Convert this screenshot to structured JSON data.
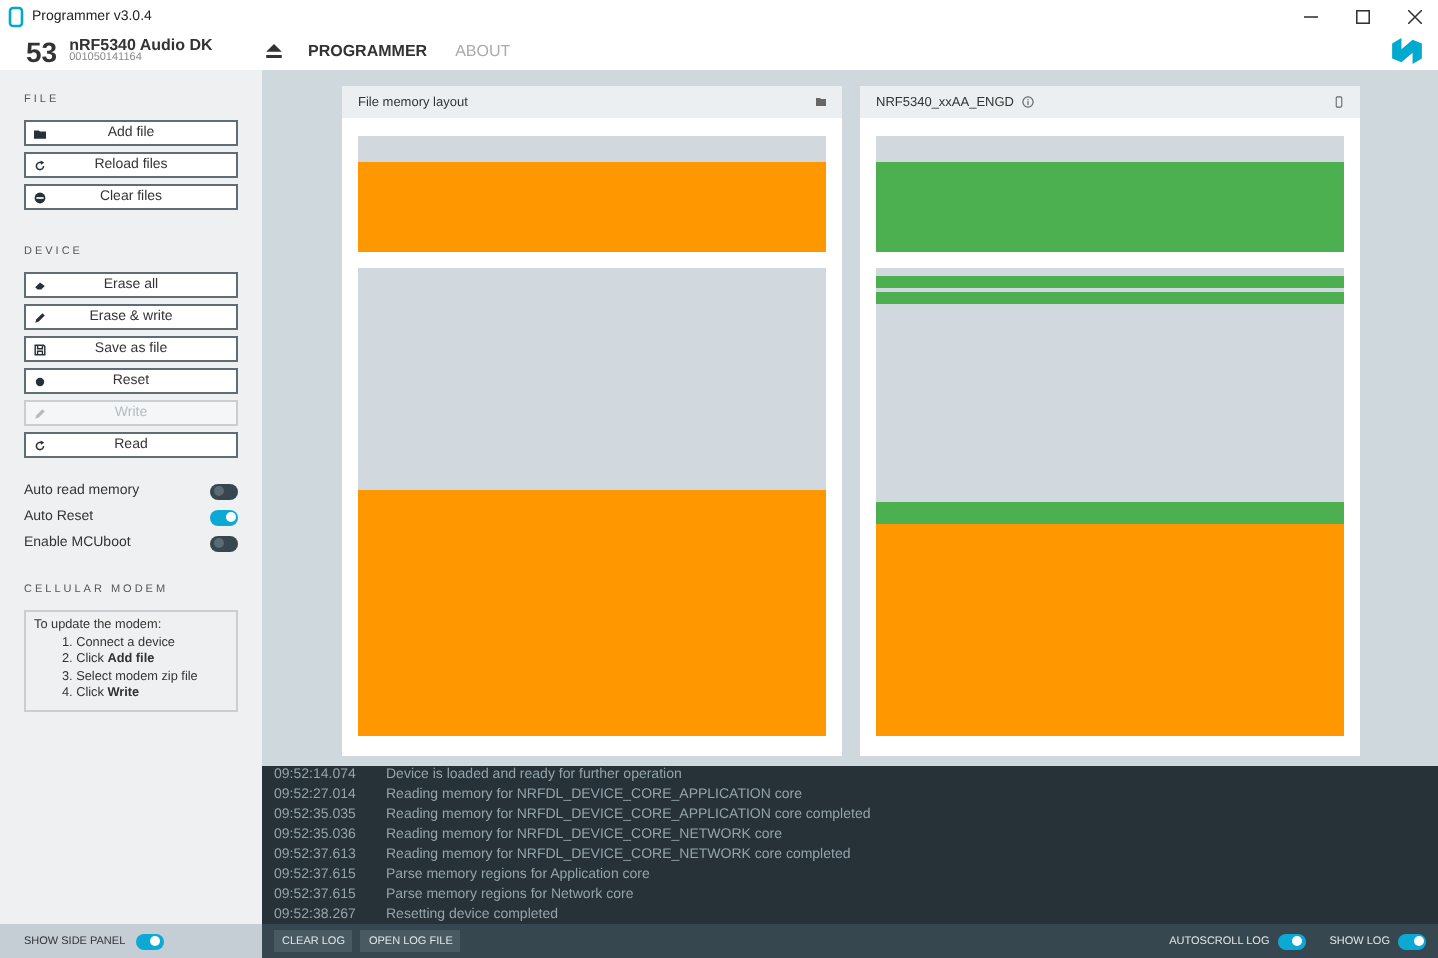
{
  "window": {
    "title": "Programmer v3.0.4"
  },
  "device": {
    "number": "53",
    "name": "nRF5340 Audio DK",
    "serial": "001050141164"
  },
  "nav": [
    {
      "label": "PROGRAMMER",
      "selected": true
    },
    {
      "label": "ABOUT",
      "selected": false
    }
  ],
  "sidebar": {
    "sections": [
      {
        "title": "FILE",
        "buttons": [
          {
            "label": "Add file",
            "kind": "folder",
            "disabled": false
          },
          {
            "label": "Reload files",
            "kind": "reload",
            "disabled": false
          },
          {
            "label": "Clear files",
            "kind": "minus",
            "disabled": false
          }
        ]
      },
      {
        "title": "DEVICE",
        "buttons": [
          {
            "label": "Erase all",
            "kind": "eraser",
            "disabled": false
          },
          {
            "label": "Erase & write",
            "kind": "pencil",
            "disabled": false
          },
          {
            "label": "Save as file",
            "kind": "save",
            "disabled": false
          },
          {
            "label": "Reset",
            "kind": "dot",
            "disabled": false
          },
          {
            "label": "Write",
            "kind": "pencil",
            "disabled": true
          },
          {
            "label": "Read",
            "kind": "reload",
            "disabled": false
          }
        ]
      }
    ],
    "toggles": [
      {
        "label": "Auto read memory",
        "on": false
      },
      {
        "label": "Auto Reset",
        "on": true
      },
      {
        "label": "Enable MCUboot",
        "on": false
      }
    ],
    "modem": {
      "title": "CELLULAR MODEM",
      "intro": "To update the modem:",
      "steps": [
        "1. Connect a device",
        "2. Click **Add file**",
        "3. Select modem zip file",
        "4. Click **Write**"
      ]
    },
    "show_side_panel": {
      "label": "SHOW SIDE PANEL",
      "on": true
    }
  },
  "cards": [
    {
      "title": "File memory layout",
      "kind": "file",
      "blocks": [
        [
          {
            "color": "#d1d9de"
          },
          {
            "color": "#ff9800"
          }
        ],
        [
          {
            "color": "#d1d9de"
          },
          {
            "color": "#ff9800"
          }
        ]
      ]
    },
    {
      "title": "NRF5340_xxAA_ENGD",
      "kind": "device",
      "blocks": [
        [
          {
            "color": "#d1d9de"
          },
          {
            "color": "#4caf50"
          }
        ],
        [
          {
            "color": "#d1d9de"
          },
          {
            "color": "#4caf50"
          },
          {
            "color": "#d1d9de"
          },
          {
            "color": "#4caf50"
          },
          {
            "color": "#d1d9de"
          },
          {
            "color": "#4caf50"
          },
          {
            "color": "#ff9800"
          }
        ]
      ]
    }
  ],
  "log": [
    {
      "time": "09:52:14.074",
      "message": "Device is loaded and ready for further operation"
    },
    {
      "time": "09:52:27.014",
      "message": "Reading memory for NRFDL_DEVICE_CORE_APPLICATION core"
    },
    {
      "time": "09:52:35.035",
      "message": "Reading memory for NRFDL_DEVICE_CORE_APPLICATION core completed"
    },
    {
      "time": "09:52:35.036",
      "message": "Reading memory for NRFDL_DEVICE_CORE_NETWORK core"
    },
    {
      "time": "09:52:37.613",
      "message": "Reading memory for NRFDL_DEVICE_CORE_NETWORK core completed"
    },
    {
      "time": "09:52:37.615",
      "message": "Parse memory regions for Application core"
    },
    {
      "time": "09:52:37.615",
      "message": "Parse memory regions for Network core"
    },
    {
      "time": "09:52:38.267",
      "message": "Resetting device completed"
    }
  ],
  "log_buttons": [
    "CLEAR LOG",
    "OPEN LOG FILE"
  ],
  "log_toggles": [
    {
      "label": "AUTOSCROLL LOG",
      "on": true
    },
    {
      "label": "SHOW LOG",
      "on": true
    }
  ]
}
